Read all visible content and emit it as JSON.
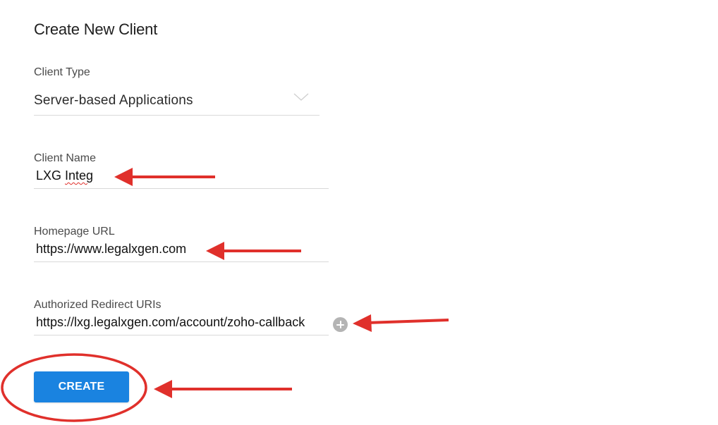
{
  "page": {
    "title": "Create New Client"
  },
  "form": {
    "client_type": {
      "label": "Client Type",
      "value": "Server-based Applications"
    },
    "client_name": {
      "label": "Client Name",
      "value_prefix": "LXG ",
      "value_misspelled": "Integ"
    },
    "homepage_url": {
      "label": "Homepage URL",
      "value": "https://www.legalxgen.com"
    },
    "redirect_uris": {
      "label": "Authorized Redirect URIs",
      "value": "https://lxg.legalxgen.com/account/zoho-callback"
    },
    "create_label": "CREATE"
  },
  "colors": {
    "primary_button": "#1a83e0",
    "annotation_red": "#e0302b",
    "add_icon_gray": "#b4b4b4"
  },
  "icons": {
    "dropdown": "chevron-down-icon",
    "add": "plus-circle-icon"
  }
}
